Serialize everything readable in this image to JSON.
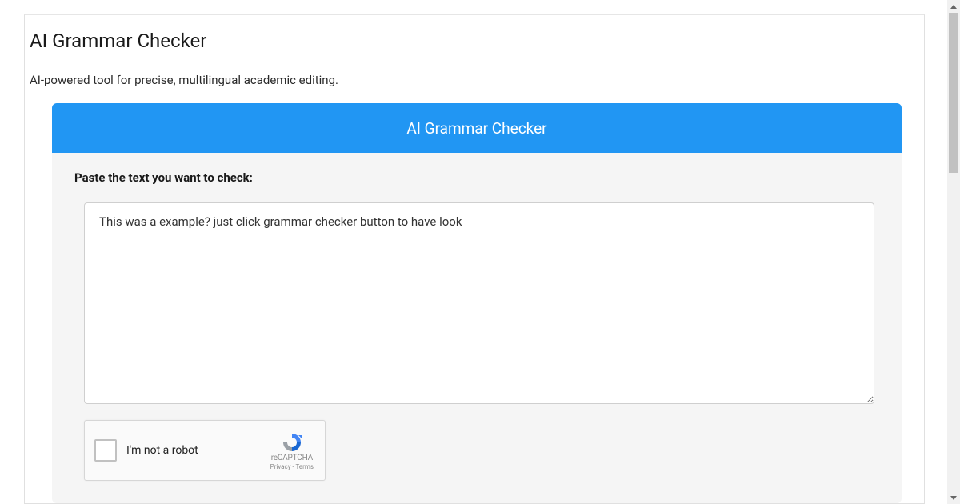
{
  "page": {
    "title": "AI Grammar Checker",
    "subtitle": "AI-powered tool for precise, multilingual academic editing."
  },
  "card": {
    "header_title": "AI Grammar Checker",
    "input_label": "Paste the text you want to check:",
    "textarea_value": "This was a example? just click grammar checker button to have look"
  },
  "recaptcha": {
    "label": "I'm not a robot",
    "brand": "reCAPTCHA",
    "links": "Privacy - Terms"
  }
}
